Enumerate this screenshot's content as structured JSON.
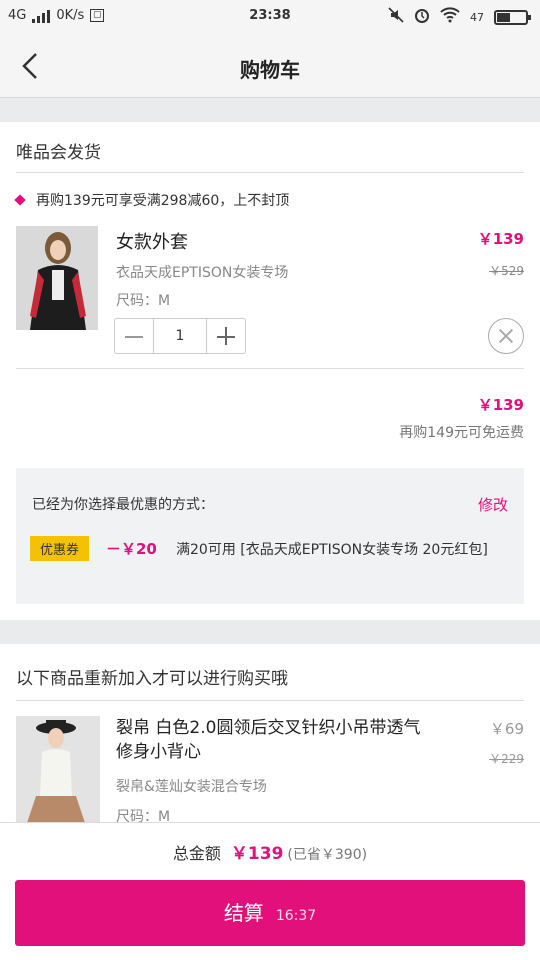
{
  "status_bar": {
    "network": "4G",
    "speed": "0K/s",
    "time": "23:38",
    "battery": "47",
    "battery_level": 0.47
  },
  "nav": {
    "title": "购物车"
  },
  "shop": {
    "title": "唯品会发货",
    "promo": "再购139元可享受满298减60，上不封顶",
    "item": {
      "name": "女款外套",
      "shop": "衣品天成EPTISON女装专场",
      "size": "尺码：M",
      "price": "￥139",
      "original_price": "￥529",
      "quantity": "1"
    },
    "subtotal": "￥139",
    "freeship_hint": "再购149元可免运费"
  },
  "coupon": {
    "title": "已经为你选择最优惠的方式：",
    "edit_label": "修改",
    "badge": "优惠券",
    "discount": "－￥20",
    "description": "满20可用 [衣品天成EPTISON女装专场 20元红包]"
  },
  "reorder": {
    "title": "以下商品重新加入才可以进行购买哦",
    "item": {
      "name": "裂帛 白色2.0圆领后交叉针织小吊带透气修身小背心",
      "shop": "裂帛&莲灿女装混合专场",
      "size": "尺码：M",
      "price": "￥69",
      "original_price": "￥229"
    }
  },
  "footer": {
    "total_label": "总金额",
    "total_amount": "￥139",
    "saved": "(已省￥390)",
    "checkout_label": "结算",
    "timer": "16:37"
  },
  "colors": {
    "accent": "#e2107b",
    "badge": "#f5c200"
  }
}
